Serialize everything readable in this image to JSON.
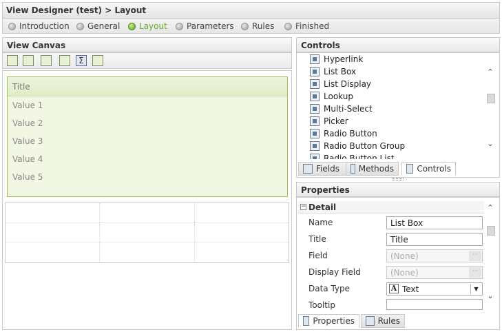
{
  "title": "View Designer (test) > Layout",
  "steps": [
    {
      "label": "Introduction",
      "active": false
    },
    {
      "label": "General",
      "active": false
    },
    {
      "label": "Layout",
      "active": true
    },
    {
      "label": "Parameters",
      "active": false
    },
    {
      "label": "Rules",
      "active": false
    },
    {
      "label": "Finished",
      "active": false
    }
  ],
  "canvas": {
    "heading": "View Canvas",
    "list": {
      "title": "Title",
      "values": [
        "Value 1",
        "Value 2",
        "Value 3",
        "Value 4",
        "Value 5"
      ]
    }
  },
  "controls": {
    "heading": "Controls",
    "items": [
      "Hyperlink",
      "List Box",
      "List Display",
      "Lookup",
      "Multi-Select",
      "Picker",
      "Radio Button",
      "Radio Button Group",
      "Radio Button List"
    ],
    "tabs": [
      {
        "label": "Fields",
        "active": false
      },
      {
        "label": "Methods",
        "active": false
      },
      {
        "label": "Controls",
        "active": true
      }
    ]
  },
  "properties": {
    "heading": "Properties",
    "section": "Detail",
    "fields": [
      {
        "label": "Name",
        "value": "List Box",
        "disabled": false
      },
      {
        "label": "Title",
        "value": "Title",
        "disabled": false
      },
      {
        "label": "Field",
        "value": "(None)",
        "disabled": true
      },
      {
        "label": "Display Field",
        "value": "(None)",
        "disabled": true
      },
      {
        "label": "Data Type",
        "value": "Text",
        "disabled": false
      },
      {
        "label": "Tooltip",
        "value": "",
        "disabled": false
      }
    ],
    "tabs": [
      {
        "label": "Properties",
        "active": true
      },
      {
        "label": "Rules",
        "active": false
      }
    ]
  }
}
